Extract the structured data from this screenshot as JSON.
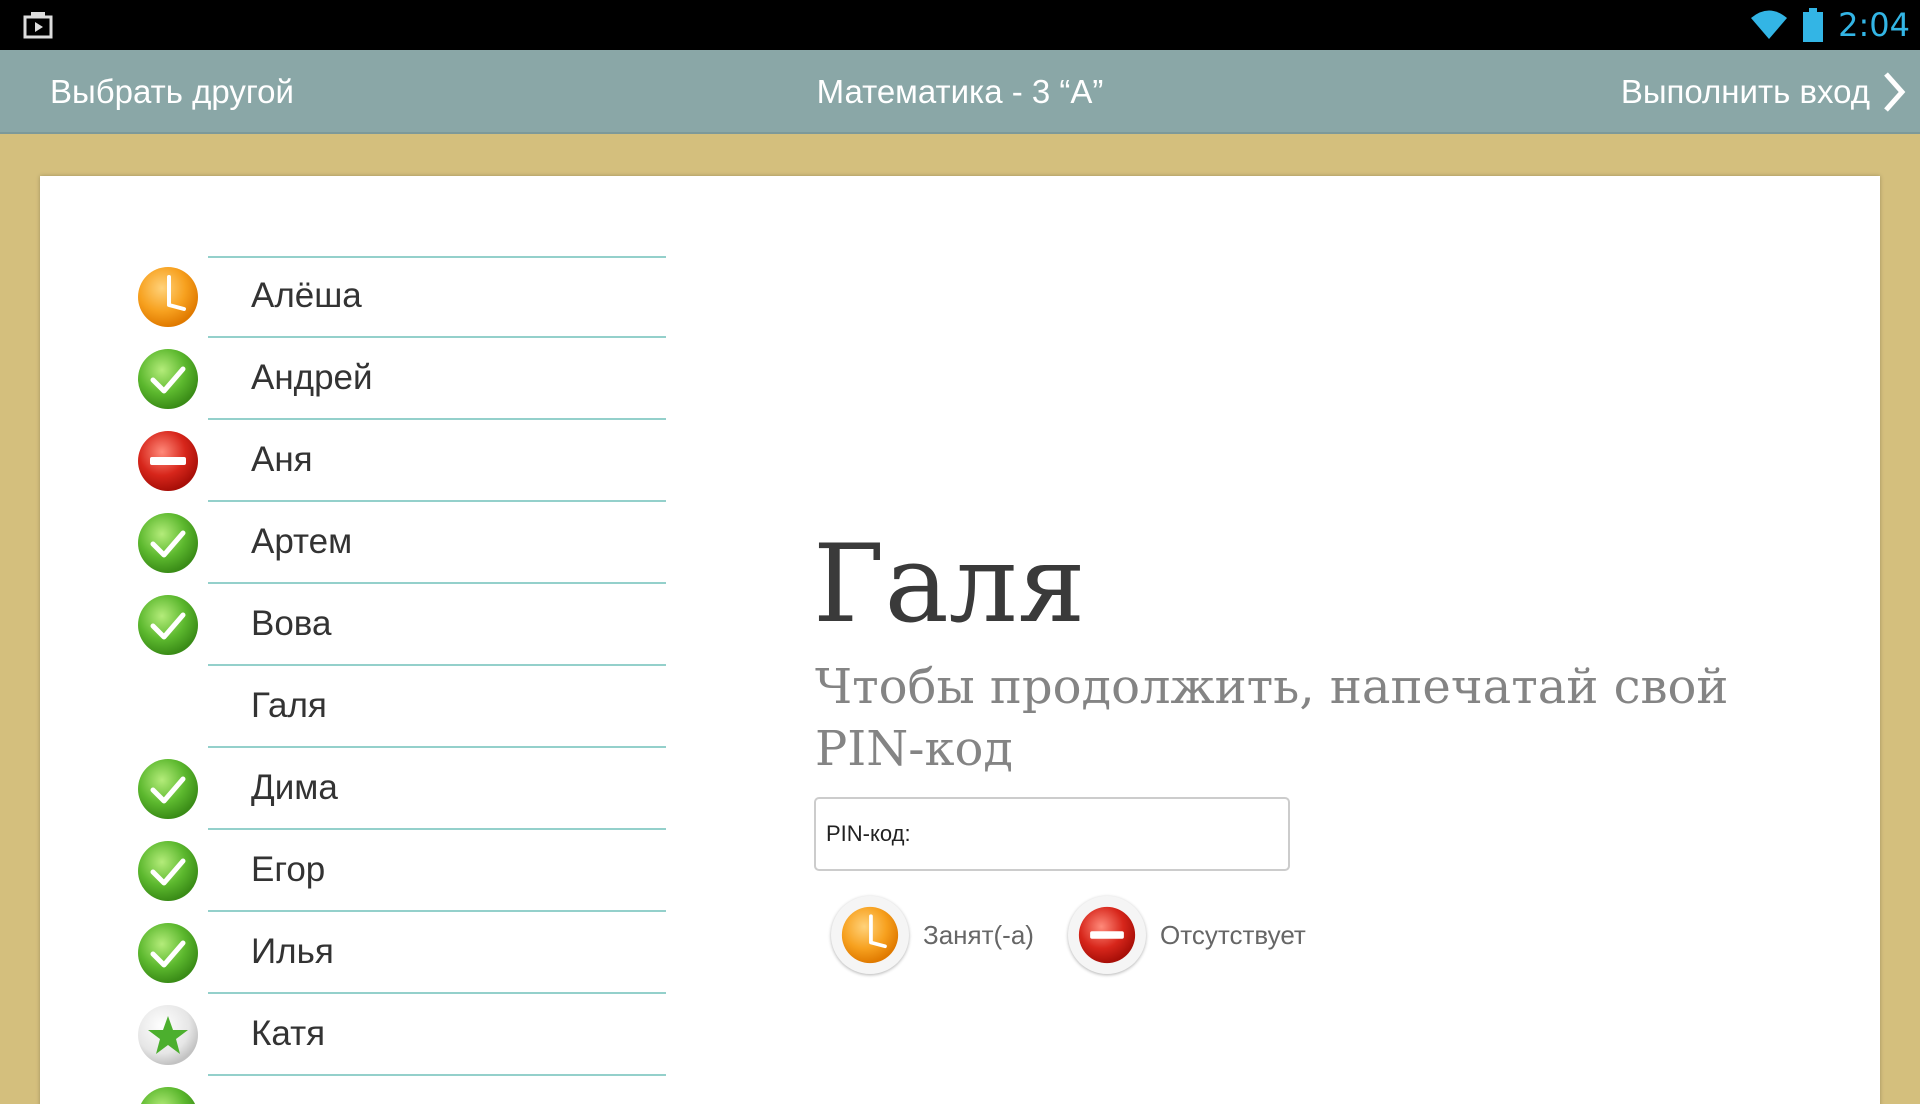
{
  "statusbar": {
    "time": "2:04",
    "left_icon": "screenshot-icon",
    "wifi_icon": "wifi-icon",
    "battery_icon": "battery-icon",
    "accent": "#33b5e5"
  },
  "actionbar": {
    "left_label": "Выбрать другой",
    "title": "Математика - 3 “А”",
    "right_label": "Выполнить вход",
    "right_icon": "chevron-right-icon",
    "bg_color": "#8aa7a7"
  },
  "students": [
    {
      "name": "Алёша",
      "status": "busy"
    },
    {
      "name": "Андрей",
      "status": "present"
    },
    {
      "name": "Аня",
      "status": "absent"
    },
    {
      "name": "Артем",
      "status": "present"
    },
    {
      "name": "Вова",
      "status": "present"
    },
    {
      "name": "Галя",
      "status": "none"
    },
    {
      "name": "Дима",
      "status": "present"
    },
    {
      "name": "Егор",
      "status": "present"
    },
    {
      "name": "Илья",
      "status": "present"
    },
    {
      "name": "Катя",
      "status": "star"
    },
    {
      "name": "",
      "status": "present"
    }
  ],
  "panel": {
    "student_name": "Галя",
    "prompt": "Чтобы продолжить, напечатай свой PIN-код",
    "pin_label": "PIN-код:",
    "busy_label": "Занят(-а)",
    "absent_label": "Отсутствует"
  },
  "colors": {
    "busy": "#f7a11f",
    "present": "#5cb82e",
    "absent": "#d7261b",
    "star": "#4caf2e",
    "list_line": "#94d0cb",
    "desk": "#d4bf7d"
  }
}
